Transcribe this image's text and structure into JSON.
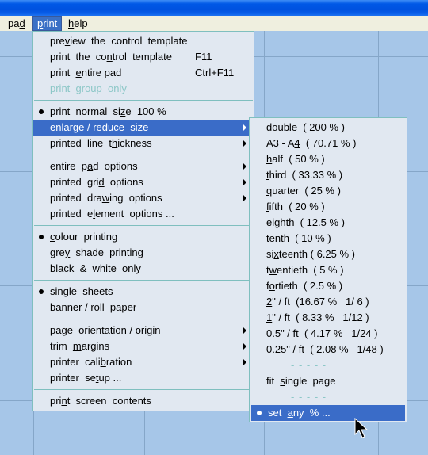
{
  "menubar": {
    "items": [
      {
        "label_pre": "pa",
        "label_u": "d",
        "label_post": ""
      },
      {
        "label_pre": "",
        "label_u": "p",
        "label_post": "rint"
      },
      {
        "label_pre": "",
        "label_u": "h",
        "label_post": "elp"
      }
    ]
  },
  "print_menu": {
    "items": [
      {
        "pre": "pre",
        "u": "v",
        "post": "iew  the  control  template",
        "shortcut": ""
      },
      {
        "pre": "print  the  co",
        "u": "n",
        "post": "trol  template",
        "shortcut": "F11"
      },
      {
        "pre": "print  ",
        "u": "e",
        "post": "ntire pad",
        "shortcut": "Ctrl+F11"
      },
      {
        "pre": "print  ",
        "u": "g",
        "post": "roup  only",
        "shortcut": ""
      },
      {
        "pre": "print  normal  si",
        "u": "z",
        "post": "e  100 %"
      },
      {
        "pre": "enlarge / red",
        "u": "u",
        "post": "ce  size"
      },
      {
        "pre": "printed  line  t",
        "u": "h",
        "post": "ickness"
      },
      {
        "pre": "entire  p",
        "u": "a",
        "post": "d  options"
      },
      {
        "pre": "printed  gri",
        "u": "d",
        "post": "  options"
      },
      {
        "pre": "printed  dra",
        "u": "w",
        "post": "ing  options"
      },
      {
        "pre": "printed  e",
        "u": "l",
        "post": "ement  options ..."
      },
      {
        "pre": "",
        "u": "c",
        "post": "olour  printing"
      },
      {
        "pre": "gre",
        "u": "y",
        "post": "  shade  printing"
      },
      {
        "pre": "blac",
        "u": "k",
        "post": "  &  white  only"
      },
      {
        "pre": "",
        "u": "s",
        "post": "ingle  sheets"
      },
      {
        "pre": "banner / ",
        "u": "r",
        "post": "oll  paper"
      },
      {
        "pre": "page  ",
        "u": "o",
        "post": "rientation / origin"
      },
      {
        "pre": "trim  ",
        "u": "m",
        "post": "argins"
      },
      {
        "pre": "printer  cali",
        "u": "b",
        "post": "ration"
      },
      {
        "pre": "printer  se",
        "u": "t",
        "post": "up ..."
      },
      {
        "pre": "pri",
        "u": "n",
        "post": "t  screen  contents"
      }
    ]
  },
  "size_submenu": {
    "items": [
      {
        "pre": "",
        "u": "d",
        "post": "ouble  ( 200 % )"
      },
      {
        "pre": "A3 - A",
        "u": "4",
        "post": "  ( 70.71 % )"
      },
      {
        "pre": "",
        "u": "h",
        "post": "alf  ( 50 % )"
      },
      {
        "pre": "",
        "u": "t",
        "post": "hird  ( 33.33 % )"
      },
      {
        "pre": "",
        "u": "q",
        "post": "uarter  ( 25 % )"
      },
      {
        "pre": "",
        "u": "f",
        "post": "ifth  ( 20 % )"
      },
      {
        "pre": "",
        "u": "e",
        "post": "ighth  ( 12.5 % )"
      },
      {
        "pre": "te",
        "u": "n",
        "post": "th  ( 10 % )"
      },
      {
        "pre": "si",
        "u": "x",
        "post": "teenth ( 6.25 % )"
      },
      {
        "pre": "t",
        "u": "w",
        "post": "entieth  ( 5 % )"
      },
      {
        "pre": "f",
        "u": "o",
        "post": "rtieth  ( 2.5 % )"
      },
      {
        "pre": "",
        "u": "2",
        "post": "\" / ft  (16.67 %   1/ 6 )"
      },
      {
        "pre": "",
        "u": "1",
        "post": "\" / ft  ( 8.33 %   1/12 )"
      },
      {
        "pre": "0.",
        "u": "5",
        "post": "\" / ft  ( 4.17 %   1/24 )"
      },
      {
        "pre": "",
        "u": "0",
        "post": ".25\" / ft  ( 2.08 %   1/48 )"
      },
      {
        "pre": "fit  ",
        "u": "s",
        "post": "ingle  page"
      },
      {
        "pre": "set  ",
        "u": "a",
        "post": "ny  % ..."
      }
    ],
    "dash_separator": "- - - - -"
  },
  "colors": {
    "highlight": "#3a6cc8",
    "menu_bg": "#e1e8f1",
    "menu_border": "#7fbfbf",
    "canvas": "#a6c6e8"
  }
}
